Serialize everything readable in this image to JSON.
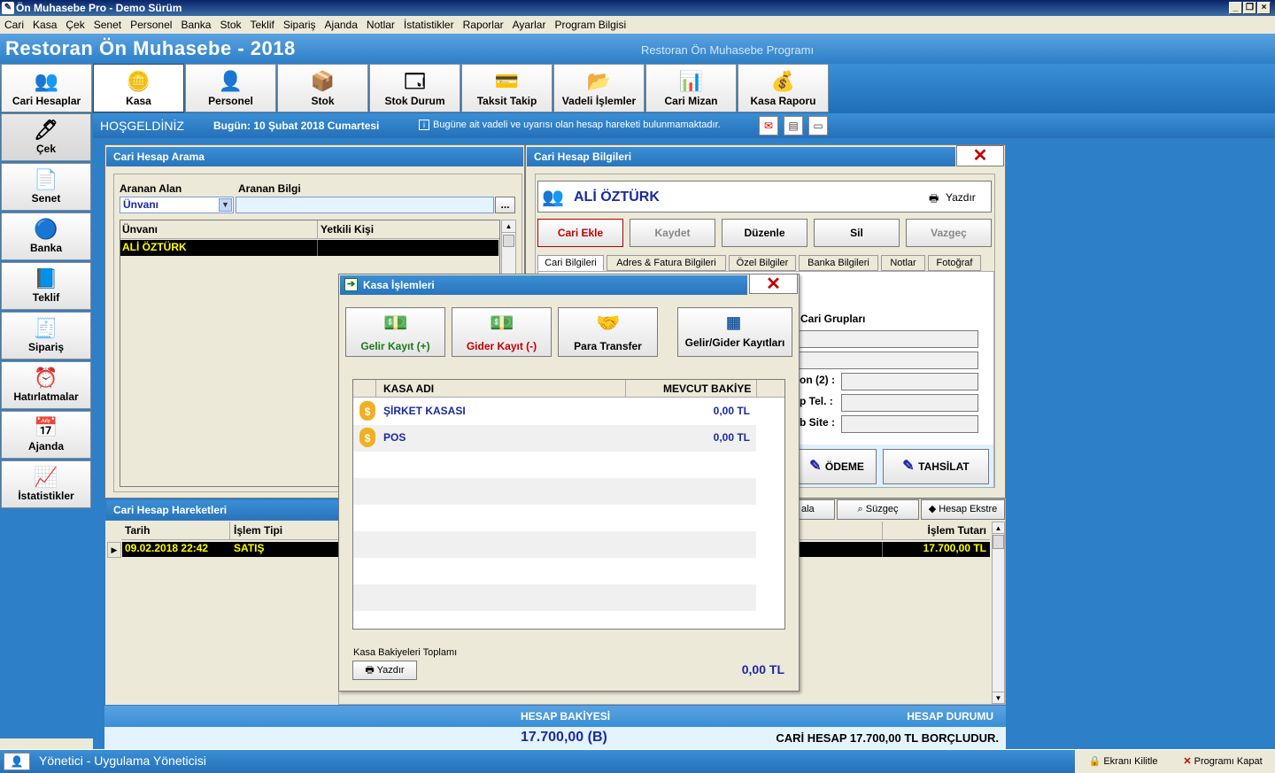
{
  "window": {
    "title": "Ön Muhasebe Pro - Demo Sürüm"
  },
  "menu": [
    "Cari",
    "Kasa",
    "Çek",
    "Senet",
    "Personel",
    "Banka",
    "Stok",
    "Teklif",
    "Sipariş",
    "Ajanda",
    "Notlar",
    "İstatistikler",
    "Raporlar",
    "Ayarlar",
    "Program Bilgisi"
  ],
  "header": {
    "title": "Restoran Ön Muhasebe - 2018",
    "subtitle": "Restoran Ön Muhasebe Programı"
  },
  "toolbar": [
    {
      "label": "Cari Hesaplar",
      "icon": "users-icon",
      "glyph": "👥"
    },
    {
      "label": "Kasa",
      "icon": "coins-icon",
      "glyph": "🪙"
    },
    {
      "label": "Personel",
      "icon": "person-icon",
      "glyph": "👤"
    },
    {
      "label": "Stok",
      "icon": "box-icon",
      "glyph": "📦"
    },
    {
      "label": "Stok Durum",
      "icon": "window-icon",
      "glyph": "🗔"
    },
    {
      "label": "Taksit Takip",
      "icon": "card-icon",
      "glyph": "💳"
    },
    {
      "label": "Vadeli İşlemler",
      "icon": "folder-icon",
      "glyph": "📂"
    },
    {
      "label": "Cari Mizan",
      "icon": "chart-icon",
      "glyph": "📊"
    },
    {
      "label": "Kasa Raporu",
      "icon": "money-bag-icon",
      "glyph": "💰"
    }
  ],
  "sidebar": [
    {
      "label": "Çek",
      "icon": "cheque-icon",
      "glyph": "🖊"
    },
    {
      "label": "Senet",
      "icon": "document-icon",
      "glyph": "📄"
    },
    {
      "label": "Banka",
      "icon": "pie-icon",
      "glyph": "🔵"
    },
    {
      "label": "Teklif",
      "icon": "notepad-icon",
      "glyph": "📘"
    },
    {
      "label": "Sipariş",
      "icon": "order-icon",
      "glyph": "🧾"
    },
    {
      "label": "Hatırlatmalar",
      "icon": "alarm-clock-icon",
      "glyph": "⏰"
    },
    {
      "label": "Ajanda",
      "icon": "calendar-icon",
      "glyph": "📅"
    },
    {
      "label": "İstatistikler",
      "icon": "statistics-icon",
      "glyph": "📈"
    }
  ],
  "welcome": {
    "greeting": "HOŞGELDİNİZ",
    "today": "Bugün: 10 Şubat 2018 Cumartesi",
    "notice": "Bugüne ait vadeli ve uyarısı olan hesap hareketi bulunmamaktadır."
  },
  "search": {
    "title": "Cari Hesap Arama",
    "field_label": "Aranan Alan",
    "info_label": "Aranan Bilgi",
    "field_value": "Ünvanı",
    "browse": "...",
    "columns": [
      "Ünvanı",
      "Yetkili Kişi"
    ],
    "rows": [
      {
        "name": "ALİ ÖZTÜRK",
        "contact": ""
      }
    ]
  },
  "movements": {
    "title": "Cari Hesap Hareketleri",
    "columns": [
      "Tarih",
      "İşlem Tipi"
    ],
    "rows": [
      {
        "date": "09.02.2018 22:42",
        "type": "SATIŞ"
      }
    ],
    "amount_header": "İşlem Tutarı",
    "amount": "17.700,00 TL",
    "tools": [
      "ala",
      "Süzgeç",
      "Hesap Ekstre"
    ]
  },
  "info": {
    "title": "Cari Hesap Bilgileri",
    "name": "ALİ ÖZTÜRK",
    "print": "Yazdır",
    "buttons": [
      "Cari Ekle",
      "Kaydet",
      "Düzenle",
      "Sil",
      "Vazgeç"
    ],
    "tabs": [
      "Cari Bilgileri",
      "Adres & Fatura Bilgileri",
      "Özel Bilgiler",
      "Banka Bilgileri",
      "Notlar",
      "Fotoğraf"
    ],
    "group_label": "Cari Grupları",
    "field_labels": [
      "on (2) :",
      "p Tel. :",
      "b Site :"
    ],
    "payment": "ÖDEME",
    "collection": "TAHSİLAT"
  },
  "summary": {
    "balance_label": "HESAP BAKİYESİ",
    "status_label": "HESAP DURUMU",
    "balance": "17.700,00 (B)",
    "status": "CARİ HESAP 17.700,00 TL BORÇLUDUR."
  },
  "kasa": {
    "title": "Kasa İşlemleri",
    "buttons": [
      {
        "label": "Gelir Kayıt (+)",
        "color": "#1a7a1a"
      },
      {
        "label": "Gider Kayıt (-)",
        "color": "#c00000"
      },
      {
        "label": "Para Transfer",
        "color": "#000000"
      },
      {
        "label": "Gelir/Gider Kayıtları",
        "color": "#000000"
      }
    ],
    "columns": [
      "KASA ADI",
      "MEVCUT BAKİYE"
    ],
    "rows": [
      {
        "name": "ŞİRKET KASASI",
        "balance": "0,00 TL"
      },
      {
        "name": "POS",
        "balance": "0,00 TL"
      }
    ],
    "total_label": "Kasa Bakiyeleri Toplamı",
    "total": "0,00 TL",
    "print": "Yazdır"
  },
  "status": {
    "user": "Yönetici - Uygulama Yöneticisi",
    "lock": "Ekranı Kilitle",
    "close": "Programı Kapat"
  },
  "colors": {
    "accent": "#2d7fc8",
    "selection": "#000000",
    "selection_text": "#ffff00",
    "link_blue": "#1a2aa0"
  }
}
